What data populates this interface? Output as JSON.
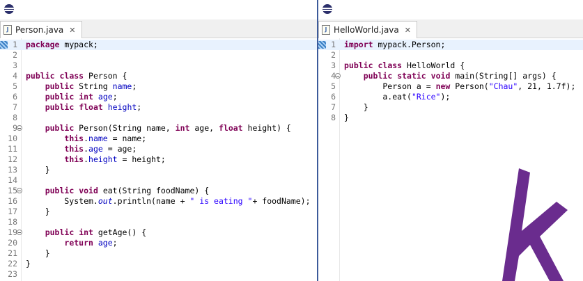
{
  "left_editor": {
    "tab_label": "Person.java",
    "file_icon": "java-file-icon",
    "close_icon": "✕",
    "lines": [
      {
        "n": "1",
        "tokens": [
          {
            "t": "package",
            "c": "kw"
          },
          {
            "t": " mypack;",
            "c": ""
          }
        ]
      },
      {
        "n": "2",
        "tokens": []
      },
      {
        "n": "3",
        "tokens": []
      },
      {
        "n": "4",
        "tokens": [
          {
            "t": "public",
            "c": "kw"
          },
          {
            "t": " ",
            "c": ""
          },
          {
            "t": "class",
            "c": "kw"
          },
          {
            "t": " Person {",
            "c": ""
          }
        ]
      },
      {
        "n": "5",
        "tokens": [
          {
            "t": "    ",
            "c": ""
          },
          {
            "t": "public",
            "c": "kw"
          },
          {
            "t": " String ",
            "c": ""
          },
          {
            "t": "name",
            "c": "fld"
          },
          {
            "t": ";",
            "c": ""
          }
        ]
      },
      {
        "n": "6",
        "tokens": [
          {
            "t": "    ",
            "c": ""
          },
          {
            "t": "public",
            "c": "kw"
          },
          {
            "t": " ",
            "c": ""
          },
          {
            "t": "int",
            "c": "kw"
          },
          {
            "t": " ",
            "c": ""
          },
          {
            "t": "age",
            "c": "fld"
          },
          {
            "t": ";",
            "c": ""
          }
        ]
      },
      {
        "n": "7",
        "tokens": [
          {
            "t": "    ",
            "c": ""
          },
          {
            "t": "public",
            "c": "kw"
          },
          {
            "t": " ",
            "c": ""
          },
          {
            "t": "float",
            "c": "kw"
          },
          {
            "t": " ",
            "c": ""
          },
          {
            "t": "height",
            "c": "fld"
          },
          {
            "t": ";",
            "c": ""
          }
        ]
      },
      {
        "n": "8",
        "tokens": []
      },
      {
        "n": "9",
        "tokens": [
          {
            "t": "    ",
            "c": ""
          },
          {
            "t": "public",
            "c": "kw"
          },
          {
            "t": " Person(String name, ",
            "c": ""
          },
          {
            "t": "int",
            "c": "kw"
          },
          {
            "t": " age, ",
            "c": ""
          },
          {
            "t": "float",
            "c": "kw"
          },
          {
            "t": " height) {",
            "c": ""
          }
        ],
        "fold": true
      },
      {
        "n": "10",
        "tokens": [
          {
            "t": "        ",
            "c": ""
          },
          {
            "t": "this",
            "c": "kw"
          },
          {
            "t": ".",
            "c": ""
          },
          {
            "t": "name",
            "c": "fld"
          },
          {
            "t": " = name;",
            "c": ""
          }
        ]
      },
      {
        "n": "11",
        "tokens": [
          {
            "t": "        ",
            "c": ""
          },
          {
            "t": "this",
            "c": "kw"
          },
          {
            "t": ".",
            "c": ""
          },
          {
            "t": "age",
            "c": "fld"
          },
          {
            "t": " = age;",
            "c": ""
          }
        ]
      },
      {
        "n": "12",
        "tokens": [
          {
            "t": "        ",
            "c": ""
          },
          {
            "t": "this",
            "c": "kw"
          },
          {
            "t": ".",
            "c": ""
          },
          {
            "t": "height",
            "c": "fld"
          },
          {
            "t": " = height;",
            "c": ""
          }
        ]
      },
      {
        "n": "13",
        "tokens": [
          {
            "t": "    }",
            "c": ""
          }
        ]
      },
      {
        "n": "14",
        "tokens": []
      },
      {
        "n": "15",
        "tokens": [
          {
            "t": "    ",
            "c": ""
          },
          {
            "t": "public",
            "c": "kw"
          },
          {
            "t": " ",
            "c": ""
          },
          {
            "t": "void",
            "c": "kw"
          },
          {
            "t": " eat(String foodName) {",
            "c": ""
          }
        ],
        "fold": true
      },
      {
        "n": "16",
        "tokens": [
          {
            "t": "        System.",
            "c": ""
          },
          {
            "t": "out",
            "c": "sta"
          },
          {
            "t": ".println(name + ",
            "c": ""
          },
          {
            "t": "\" is eating \"",
            "c": "str"
          },
          {
            "t": "+ foodName);",
            "c": ""
          }
        ]
      },
      {
        "n": "17",
        "tokens": [
          {
            "t": "    }",
            "c": ""
          }
        ]
      },
      {
        "n": "18",
        "tokens": []
      },
      {
        "n": "19",
        "tokens": [
          {
            "t": "    ",
            "c": ""
          },
          {
            "t": "public",
            "c": "kw"
          },
          {
            "t": " ",
            "c": ""
          },
          {
            "t": "int",
            "c": "kw"
          },
          {
            "t": " getAge() {",
            "c": ""
          }
        ],
        "fold": true
      },
      {
        "n": "20",
        "tokens": [
          {
            "t": "        ",
            "c": ""
          },
          {
            "t": "return",
            "c": "kw"
          },
          {
            "t": " ",
            "c": ""
          },
          {
            "t": "age",
            "c": "fld"
          },
          {
            "t": ";",
            "c": ""
          }
        ]
      },
      {
        "n": "21",
        "tokens": [
          {
            "t": "    }",
            "c": ""
          }
        ]
      },
      {
        "n": "22",
        "tokens": [
          {
            "t": "}",
            "c": ""
          }
        ]
      },
      {
        "n": "23",
        "tokens": []
      }
    ]
  },
  "right_editor": {
    "tab_label": "HelloWorld.java",
    "file_icon": "java-file-icon",
    "close_icon": "✕",
    "lines": [
      {
        "n": "1",
        "tokens": [
          {
            "t": "import",
            "c": "kw"
          },
          {
            "t": " mypack.Person;",
            "c": ""
          }
        ]
      },
      {
        "n": "2",
        "tokens": []
      },
      {
        "n": "3",
        "tokens": [
          {
            "t": "public",
            "c": "kw"
          },
          {
            "t": " ",
            "c": ""
          },
          {
            "t": "class",
            "c": "kw"
          },
          {
            "t": " HelloWorld {",
            "c": ""
          }
        ]
      },
      {
        "n": "4",
        "tokens": [
          {
            "t": "    ",
            "c": ""
          },
          {
            "t": "public",
            "c": "kw"
          },
          {
            "t": " ",
            "c": ""
          },
          {
            "t": "static",
            "c": "kw"
          },
          {
            "t": " ",
            "c": ""
          },
          {
            "t": "void",
            "c": "kw"
          },
          {
            "t": " main(String[] args) {",
            "c": ""
          }
        ],
        "fold": true
      },
      {
        "n": "5",
        "tokens": [
          {
            "t": "        Person a = ",
            "c": ""
          },
          {
            "t": "new",
            "c": "kw"
          },
          {
            "t": " Person(",
            "c": ""
          },
          {
            "t": "\"Chau\"",
            "c": "str"
          },
          {
            "t": ", 21, 1.7f);",
            "c": ""
          }
        ]
      },
      {
        "n": "6",
        "tokens": [
          {
            "t": "        a.eat(",
            "c": ""
          },
          {
            "t": "\"Rice\"",
            "c": "str"
          },
          {
            "t": ");",
            "c": ""
          }
        ]
      },
      {
        "n": "7",
        "tokens": [
          {
            "t": "    }",
            "c": ""
          }
        ]
      },
      {
        "n": "8",
        "tokens": [
          {
            "t": "}",
            "c": ""
          }
        ]
      }
    ]
  },
  "colors": {
    "keyword": "#7f0055",
    "field": "#0000c0",
    "string": "#2a00ff",
    "current_line": "#e8f2fe",
    "logo": "#6a2c8e"
  },
  "logo_icon": "h-logo-icon"
}
